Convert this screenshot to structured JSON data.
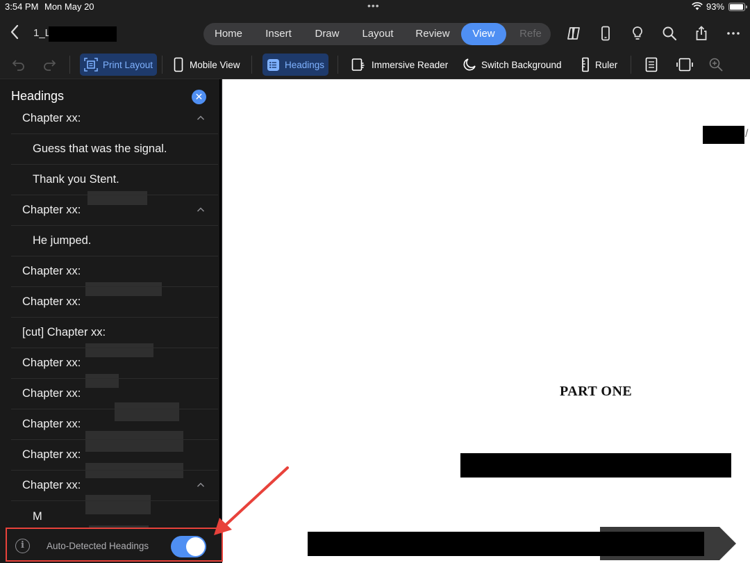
{
  "status_bar": {
    "time": "3:54 PM",
    "date": "Mon May 20",
    "battery": "93%"
  },
  "document": {
    "title": "1_L"
  },
  "tabs": [
    {
      "label": "Home"
    },
    {
      "label": "Insert"
    },
    {
      "label": "Draw"
    },
    {
      "label": "Layout"
    },
    {
      "label": "Review"
    },
    {
      "label": "View"
    },
    {
      "label": "Refe"
    }
  ],
  "active_tab": "View",
  "ribbon": {
    "print_layout": "Print Layout",
    "mobile_view": "Mobile View",
    "headings": "Headings",
    "immersive_reader": "Immersive Reader",
    "switch_background": "Switch Background",
    "ruler": "Ruler"
  },
  "sidebar": {
    "title": "Headings",
    "items": [
      {
        "label": "Chapter xx:",
        "level": 1,
        "expanded": true
      },
      {
        "label": "Guess that was the signal.",
        "level": 2
      },
      {
        "label": "Thank you Stent.",
        "level": 2
      },
      {
        "label": "Chapter xx:",
        "level": 1,
        "expanded": true
      },
      {
        "label": "He jumped.",
        "level": 2
      },
      {
        "label": "Chapter xx:",
        "level": 1
      },
      {
        "label": "Chapter xx:",
        "level": 1
      },
      {
        "label": "[cut] Chapter xx:",
        "level": 1
      },
      {
        "label": "Chapter xx:",
        "level": 1
      },
      {
        "label": "Chapter xx:",
        "level": 1
      },
      {
        "label": "Chapter xx:",
        "level": 1
      },
      {
        "label": "Chapter xx:",
        "level": 1
      },
      {
        "label": "Chapter xx:",
        "level": 1,
        "expanded": true
      },
      {
        "label": "M",
        "level": 2
      }
    ],
    "footer_label": "Auto-Detected Headings",
    "auto_detect_enabled": true
  },
  "page": {
    "heading": "PART ONE"
  },
  "colors": {
    "accent": "#4f8ff3",
    "annotation": "#e8423b"
  }
}
